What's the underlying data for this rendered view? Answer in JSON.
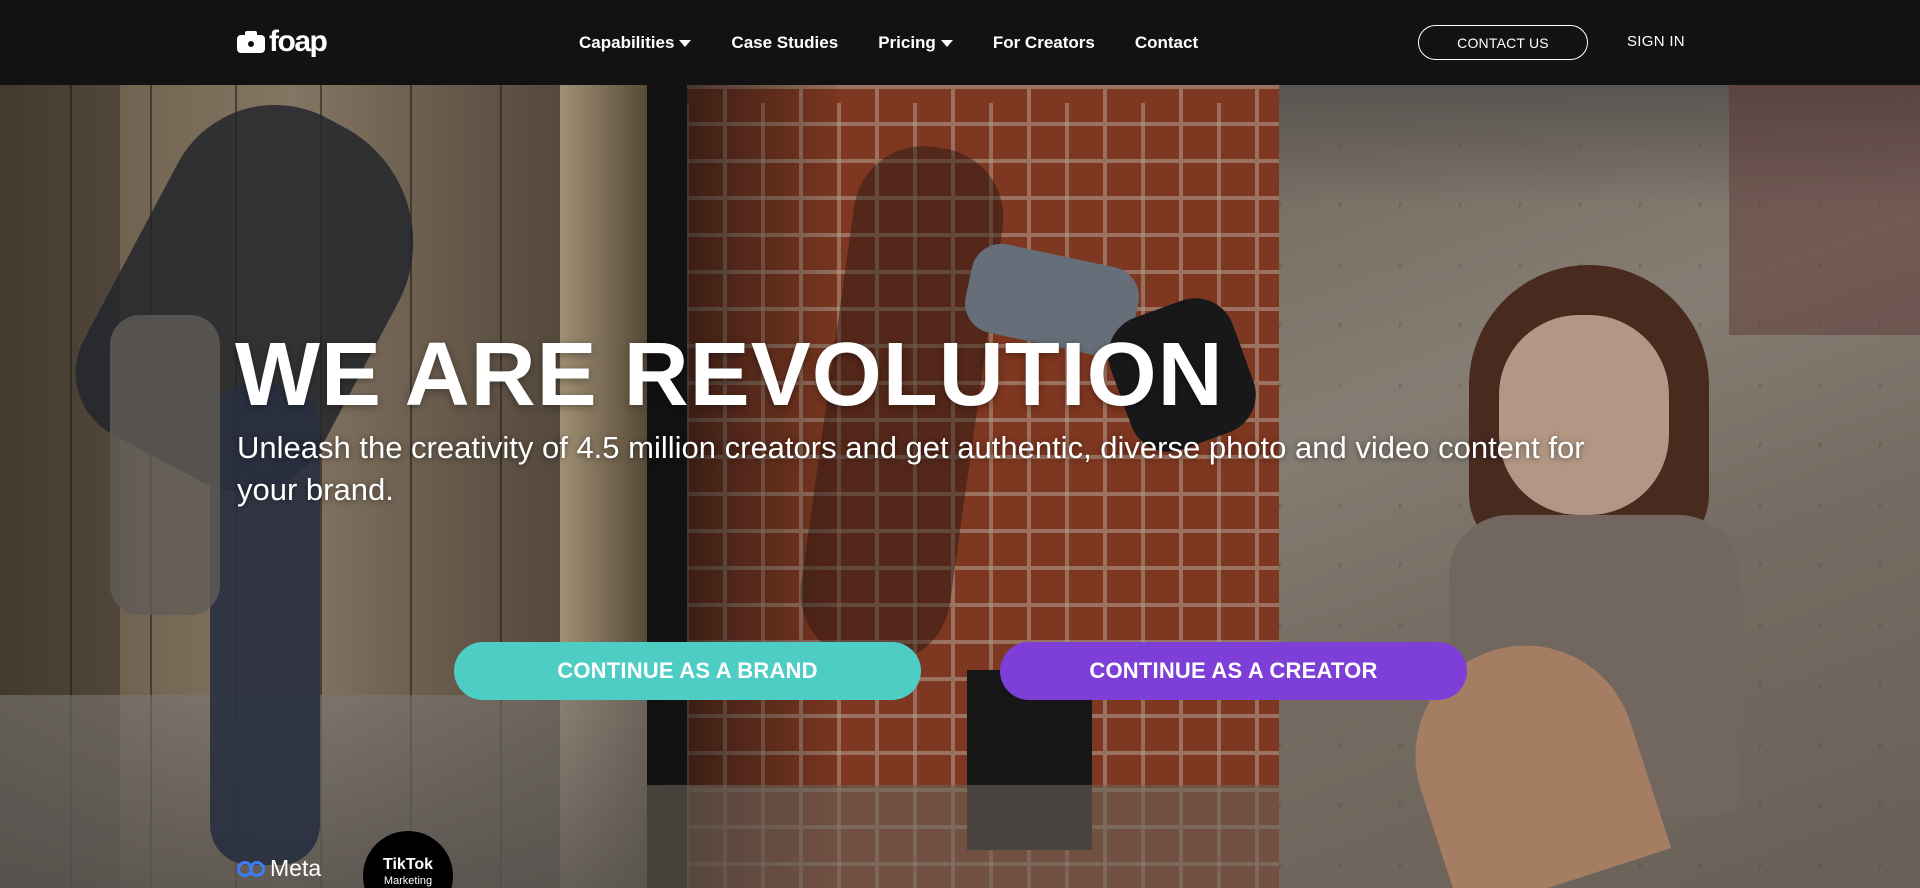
{
  "nav": {
    "logo_text": "foap",
    "items": [
      {
        "label": "Capabilities",
        "dropdown": true
      },
      {
        "label": "Case Studies",
        "dropdown": false
      },
      {
        "label": "Pricing",
        "dropdown": true
      },
      {
        "label": "For Creators",
        "dropdown": false
      },
      {
        "label": "Contact",
        "dropdown": false
      }
    ],
    "contact_button": "CONTACT US",
    "sign_in": "SIGN IN"
  },
  "hero": {
    "headline": "WE ARE REVOLUTION",
    "subheadline": "Unleash the creativity of 4.5 million creators and get authentic, diverse photo and video content for your brand.",
    "cta_brand": "CONTINUE AS A BRAND",
    "cta_creator": "CONTINUE AS A CREATOR"
  },
  "partners": {
    "meta": "Meta",
    "tiktok": "TikTok",
    "tiktok_sub": "Marketing"
  },
  "colors": {
    "nav_bg": "#121212",
    "cta_brand": "#4ecdc4",
    "cta_creator": "#7e3fd8",
    "meta_blue": "#3d7cf3"
  },
  "icons": {
    "logo": "camera-icon",
    "dropdown": "caret-down-icon"
  }
}
